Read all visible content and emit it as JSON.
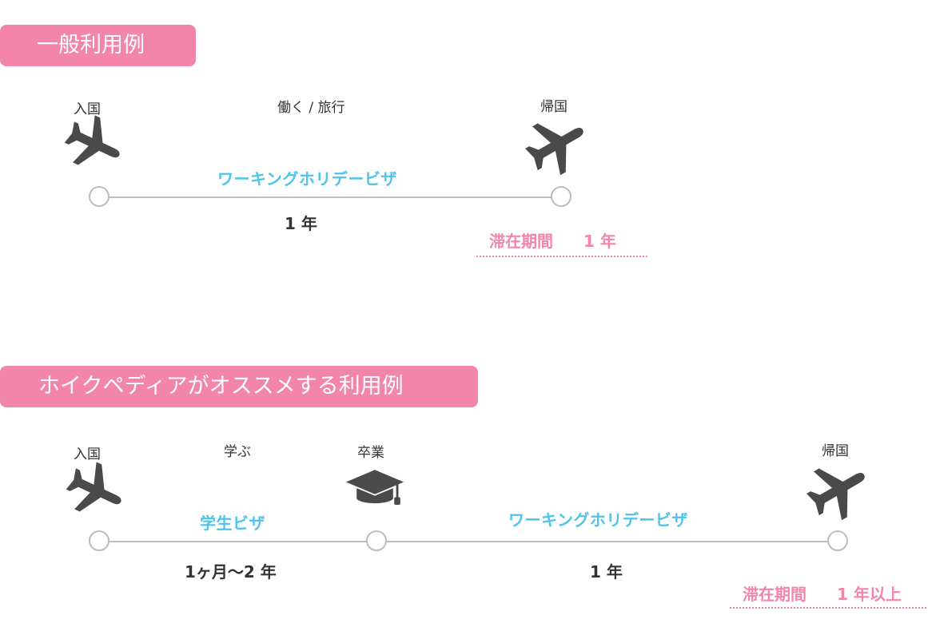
{
  "section1": {
    "title": "一般利用例",
    "entry_label": "入国",
    "activity_label": "働く / 旅行",
    "return_label": "帰国",
    "visa_label": "ワーキングホリデービザ",
    "duration": "1 年",
    "stay_label": "滞在期間",
    "stay_value": "1 年"
  },
  "section2": {
    "title": "ホイクペディアがオススメする利用例",
    "entry_label": "入国",
    "activity_label": "学ぶ",
    "graduate_label": "卒業",
    "return_label": "帰国",
    "visa1_label": "学生ビザ",
    "duration1": "1ヶ月〜2 年",
    "visa2_label": "ワーキングホリデービザ",
    "duration2": "1 年",
    "stay_label": "滞在期間",
    "stay_value": "1 年以上"
  },
  "colors": {
    "pink": "#f285a9",
    "blue": "#4ec3ec",
    "gray_line": "#bdbdbd",
    "icon": "#4a4a4a"
  },
  "icons": [
    "airplane-landing-icon",
    "airplane-takeoff-icon",
    "graduation-cap-icon"
  ]
}
